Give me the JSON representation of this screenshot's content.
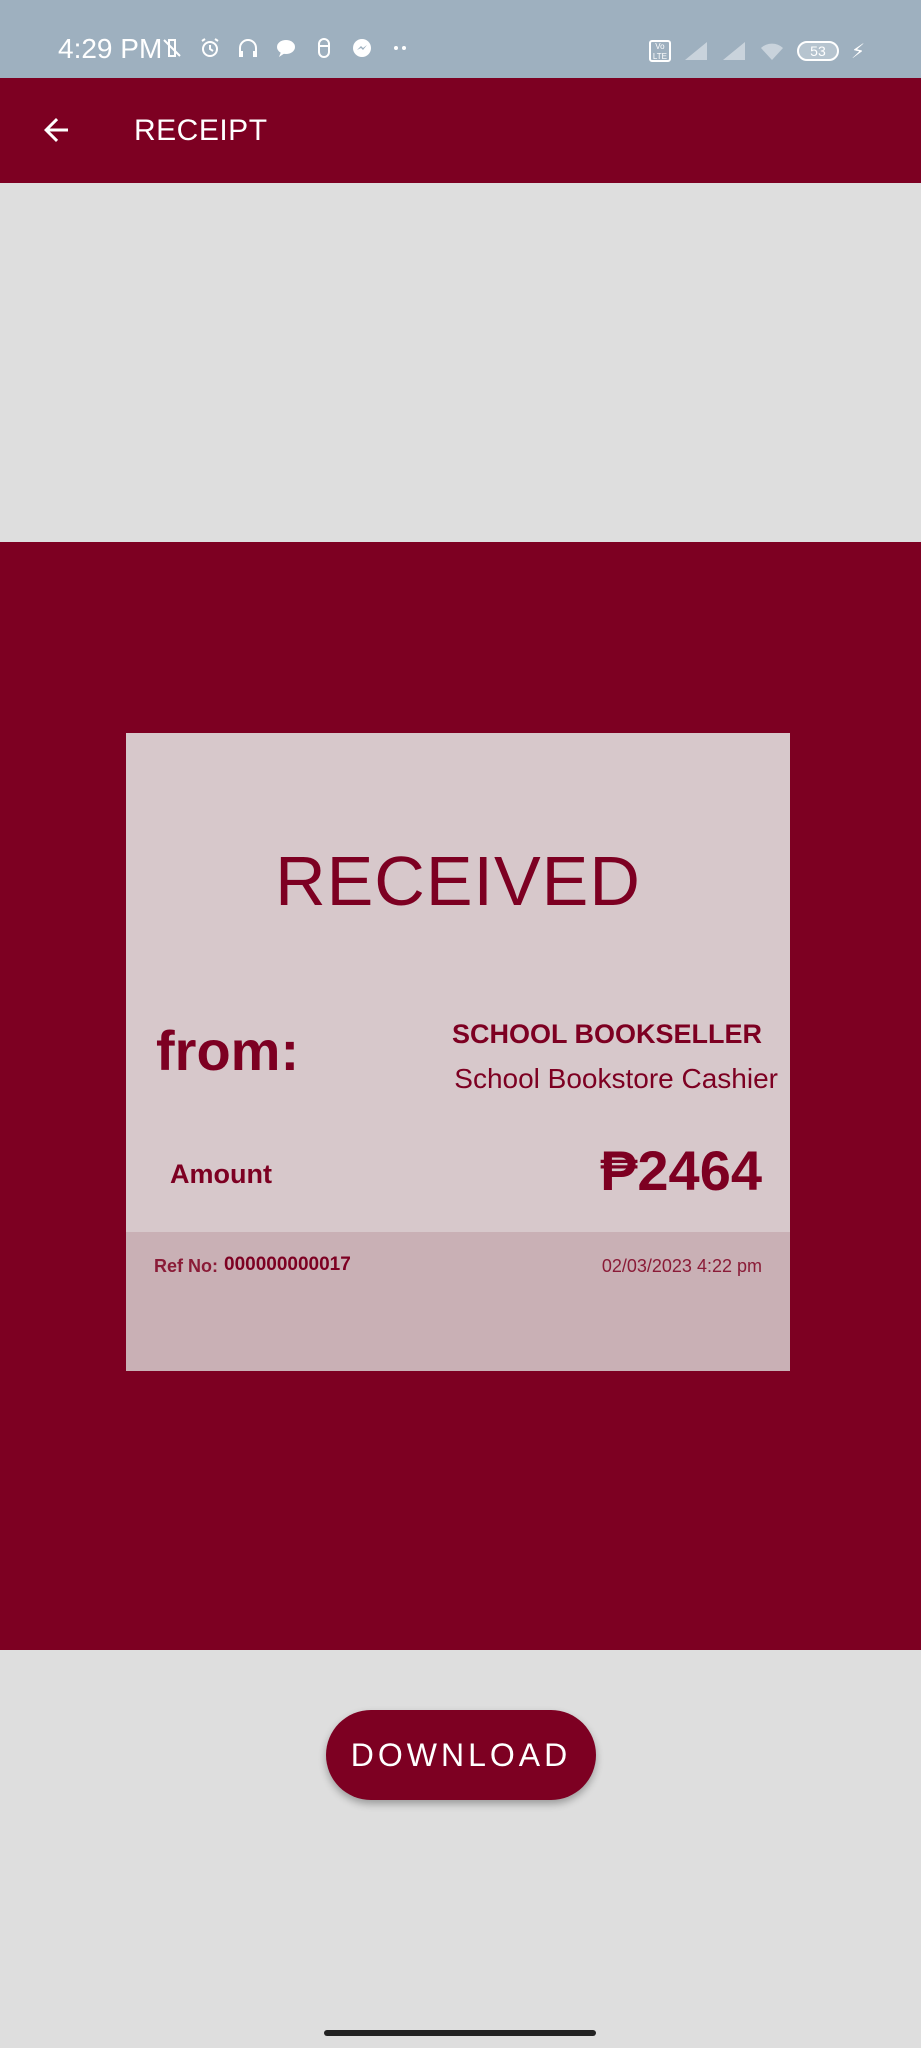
{
  "status_bar": {
    "time": "4:29 PM",
    "icons_left": [
      "mute-vibrate-icon",
      "alarm-icon",
      "headset-icon",
      "chat-bubble-icon",
      "clip-icon",
      "messenger-icon",
      "more-dots-icon"
    ],
    "icons_right": [
      "volte-icon",
      "signal-icon",
      "signal-icon",
      "wifi-icon",
      "battery-icon",
      "charging-icon"
    ],
    "volte_text": "Vo LTE",
    "battery_level": "53"
  },
  "app_bar": {
    "title": "RECEIPT",
    "back_icon": "arrow-left-icon"
  },
  "receipt": {
    "status_title": "RECEIVED",
    "from_label": "from:",
    "seller_name": "SCHOOL BOOKSELLER",
    "seller_role": "School Bookstore Cashier",
    "amount_label": "Amount",
    "amount_value": "₱2464",
    "ref_label": "Ref No:",
    "ref_number": "000000000017",
    "datetime": "02/03/2023 4:22 pm"
  },
  "actions": {
    "download_label": "DOWNLOAD"
  },
  "colors": {
    "brand": "#7d0022",
    "card": "#d7c8cb",
    "card_footer": "#c9b0b5",
    "background": "#dedede",
    "status_bar": "#9eb0bf"
  }
}
